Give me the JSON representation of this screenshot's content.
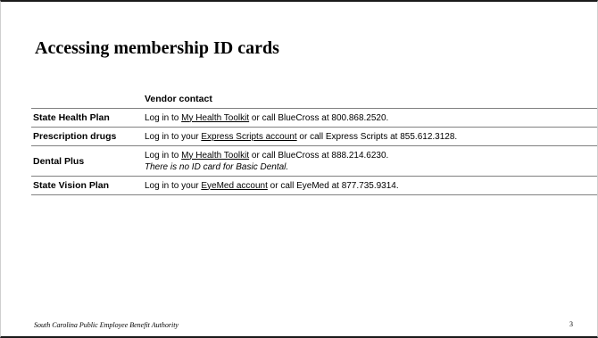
{
  "slide": {
    "title": "Accessing membership ID cards",
    "footer": "South Carolina Public Employee Benefit Authority",
    "page_number": "3"
  },
  "table": {
    "header": "Vendor contact",
    "rows": [
      {
        "label": "State Health Plan",
        "pre": "Log in to ",
        "link": "My Health Toolkit",
        "post": " or call BlueCross at 800.868.2520.",
        "note": ""
      },
      {
        "label": "Prescription drugs",
        "pre": "Log in to your ",
        "link": "Express Scripts account",
        "post": " or call Express Scripts at 855.612.3128.",
        "note": ""
      },
      {
        "label": "Dental Plus",
        "pre": "Log in to ",
        "link": "My Health Toolkit",
        "post": " or call BlueCross at 888.214.6230.",
        "note": "There is no ID card for Basic Dental."
      },
      {
        "label": "State Vision Plan",
        "pre": "Log in to your ",
        "link": "EyeMed account",
        "post": " or call EyeMed at 877.735.9314.",
        "note": ""
      }
    ]
  }
}
